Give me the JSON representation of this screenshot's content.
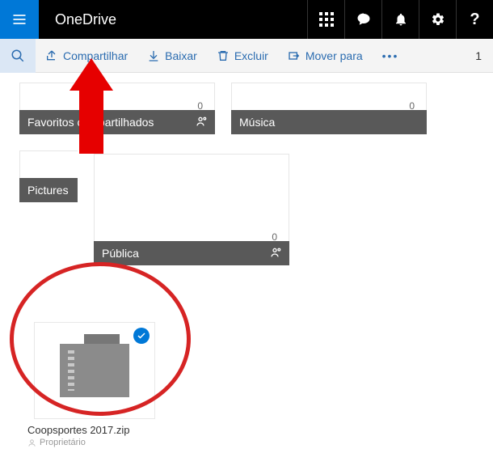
{
  "header": {
    "brand": "OneDrive"
  },
  "toolbar": {
    "share": "Compartilhar",
    "download": "Baixar",
    "delete": "Excluir",
    "move": "Mover para",
    "selected_count": "1"
  },
  "tiles": [
    {
      "name": "Favoritos compartilhados",
      "count": "0"
    },
    {
      "name": "Música",
      "count": "0"
    },
    {
      "name": "Pictures",
      "count": ""
    },
    {
      "name": "Pública",
      "count": "0"
    }
  ],
  "file": {
    "name": "Coopsportes 2017.zip",
    "owner": "Proprietário"
  }
}
